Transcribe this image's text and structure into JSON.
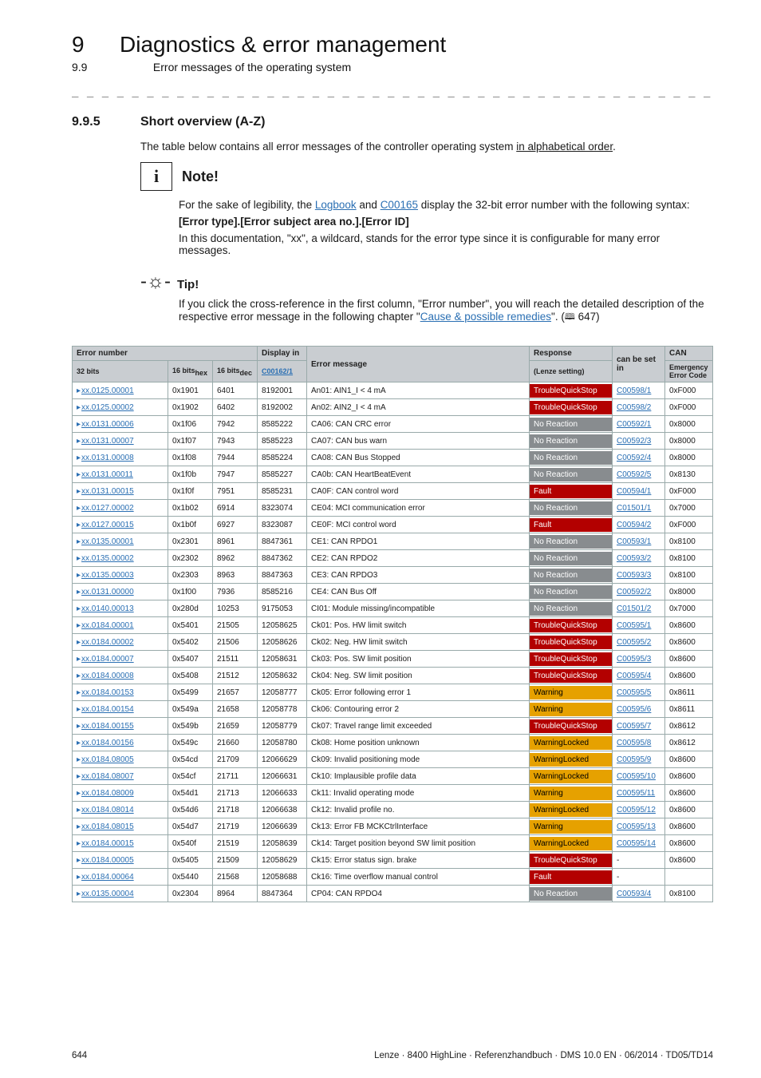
{
  "header": {
    "chapter_num": "9",
    "chapter_title": "Diagnostics & error management",
    "section_num": "9.9",
    "section_title": "Error messages of the operating system"
  },
  "sec": {
    "num": "9.9.5",
    "title": "Short overview (A-Z)"
  },
  "intro": {
    "pre": "The table below contains all error messages of the controller operating system ",
    "ul": "in alphabetical order",
    "post": "."
  },
  "note": {
    "title": "Note!",
    "p1a": "For the sake of legibility, the ",
    "link1": "Logbook",
    "p1b": " and ",
    "link2": "C00165",
    "p1c": " display the 32-bit error number with the following syntax:",
    "codeline": "[Error type].[Error subject area no.].[Error ID]",
    "p2": "In this documentation, \"xx\", a wildcard, stands for the error type since it is configurable for many error messages."
  },
  "tip": {
    "title": "Tip!",
    "p1": "If you click the cross-reference in the first column, \"Error number\", you will reach the detailed description of the respective error message in the following chapter \"",
    "link": "Cause & possible remedies",
    "p2": "\". ",
    "pageref": "647)"
  },
  "thead": {
    "c1a": "Error number",
    "c1b": "32 bits",
    "c2": "16 bits",
    "c2sub": "hex",
    "c3": "16 bits",
    "c3sub": "dec",
    "c4a": "Display in",
    "c4b": "C00162/1",
    "c5": "Error message",
    "c6a": "Response",
    "c6b": "(Lenze setting)",
    "c7": "can be set in",
    "c8a": "CAN",
    "c8b": "Emergency Error Code"
  },
  "rows": [
    {
      "en": "xx.0125.00001",
      "hex": "0x1901",
      "dec": "6401",
      "disp": "8192001",
      "msg": "An01: AIN1_I < 4 mA",
      "resp": "TroubleQuickStop",
      "set": "C00598/1",
      "can": "0xF000"
    },
    {
      "en": "xx.0125.00002",
      "hex": "0x1902",
      "dec": "6402",
      "disp": "8192002",
      "msg": "An02: AIN2_I < 4 mA",
      "resp": "TroubleQuickStop",
      "set": "C00598/2",
      "can": "0xF000"
    },
    {
      "en": "xx.0131.00006",
      "hex": "0x1f06",
      "dec": "7942",
      "disp": "8585222",
      "msg": "CA06: CAN CRC error",
      "resp": "No Reaction",
      "set": "C00592/1",
      "can": "0x8000"
    },
    {
      "en": "xx.0131.00007",
      "hex": "0x1f07",
      "dec": "7943",
      "disp": "8585223",
      "msg": "CA07: CAN bus warn",
      "resp": "No Reaction",
      "set": "C00592/3",
      "can": "0x8000"
    },
    {
      "en": "xx.0131.00008",
      "hex": "0x1f08",
      "dec": "7944",
      "disp": "8585224",
      "msg": "CA08: CAN Bus Stopped",
      "resp": "No Reaction",
      "set": "C00592/4",
      "can": "0x8000"
    },
    {
      "en": "xx.0131.00011",
      "hex": "0x1f0b",
      "dec": "7947",
      "disp": "8585227",
      "msg": "CA0b: CAN HeartBeatEvent",
      "resp": "No Reaction",
      "set": "C00592/5",
      "can": "0x8130"
    },
    {
      "en": "xx.0131.00015",
      "hex": "0x1f0f",
      "dec": "7951",
      "disp": "8585231",
      "msg": "CA0F: CAN control word",
      "resp": "Fault",
      "set": "C00594/1",
      "can": "0xF000"
    },
    {
      "en": "xx.0127.00002",
      "hex": "0x1b02",
      "dec": "6914",
      "disp": "8323074",
      "msg": "CE04: MCI communication error",
      "resp": "No Reaction",
      "set": "C01501/1",
      "can": "0x7000"
    },
    {
      "en": "xx.0127.00015",
      "hex": "0x1b0f",
      "dec": "6927",
      "disp": "8323087",
      "msg": "CE0F: MCI control word",
      "resp": "Fault",
      "set": "C00594/2",
      "can": "0xF000"
    },
    {
      "en": "xx.0135.00001",
      "hex": "0x2301",
      "dec": "8961",
      "disp": "8847361",
      "msg": "CE1: CAN RPDO1",
      "resp": "No Reaction",
      "set": "C00593/1",
      "can": "0x8100"
    },
    {
      "en": "xx.0135.00002",
      "hex": "0x2302",
      "dec": "8962",
      "disp": "8847362",
      "msg": "CE2: CAN RPDO2",
      "resp": "No Reaction",
      "set": "C00593/2",
      "can": "0x8100"
    },
    {
      "en": "xx.0135.00003",
      "hex": "0x2303",
      "dec": "8963",
      "disp": "8847363",
      "msg": "CE3: CAN RPDO3",
      "resp": "No Reaction",
      "set": "C00593/3",
      "can": "0x8100"
    },
    {
      "en": "xx.0131.00000",
      "hex": "0x1f00",
      "dec": "7936",
      "disp": "8585216",
      "msg": "CE4: CAN Bus Off",
      "resp": "No Reaction",
      "set": "C00592/2",
      "can": "0x8000"
    },
    {
      "en": "xx.0140.00013",
      "hex": "0x280d",
      "dec": "10253",
      "disp": "9175053",
      "msg": "CI01: Module missing/incompatible",
      "resp": "No Reaction",
      "set": "C01501/2",
      "can": "0x7000"
    },
    {
      "en": "xx.0184.00001",
      "hex": "0x5401",
      "dec": "21505",
      "disp": "12058625",
      "msg": "Ck01: Pos. HW limit switch",
      "resp": "TroubleQuickStop",
      "set": "C00595/1",
      "can": "0x8600"
    },
    {
      "en": "xx.0184.00002",
      "hex": "0x5402",
      "dec": "21506",
      "disp": "12058626",
      "msg": "Ck02: Neg. HW limit switch",
      "resp": "TroubleQuickStop",
      "set": "C00595/2",
      "can": "0x8600"
    },
    {
      "en": "xx.0184.00007",
      "hex": "0x5407",
      "dec": "21511",
      "disp": "12058631",
      "msg": "Ck03: Pos. SW limit position",
      "resp": "TroubleQuickStop",
      "set": "C00595/3",
      "can": "0x8600"
    },
    {
      "en": "xx.0184.00008",
      "hex": "0x5408",
      "dec": "21512",
      "disp": "12058632",
      "msg": "Ck04: Neg. SW limit position",
      "resp": "TroubleQuickStop",
      "set": "C00595/4",
      "can": "0x8600"
    },
    {
      "en": "xx.0184.00153",
      "hex": "0x5499",
      "dec": "21657",
      "disp": "12058777",
      "msg": "Ck05: Error following error 1",
      "resp": "Warning",
      "set": "C00595/5",
      "can": "0x8611"
    },
    {
      "en": "xx.0184.00154",
      "hex": "0x549a",
      "dec": "21658",
      "disp": "12058778",
      "msg": "Ck06: Contouring error 2",
      "resp": "Warning",
      "set": "C00595/6",
      "can": "0x8611"
    },
    {
      "en": "xx.0184.00155",
      "hex": "0x549b",
      "dec": "21659",
      "disp": "12058779",
      "msg": "Ck07: Travel range limit exceeded",
      "resp": "TroubleQuickStop",
      "set": "C00595/7",
      "can": "0x8612"
    },
    {
      "en": "xx.0184.00156",
      "hex": "0x549c",
      "dec": "21660",
      "disp": "12058780",
      "msg": "Ck08: Home position unknown",
      "resp": "WarningLocked",
      "set": "C00595/8",
      "can": "0x8612"
    },
    {
      "en": "xx.0184.08005",
      "hex": "0x54cd",
      "dec": "21709",
      "disp": "12066629",
      "msg": "Ck09: Invalid positioning mode",
      "resp": "WarningLocked",
      "set": "C00595/9",
      "can": "0x8600"
    },
    {
      "en": "xx.0184.08007",
      "hex": "0x54cf",
      "dec": "21711",
      "disp": "12066631",
      "msg": "Ck10: Implausible profile data",
      "resp": "WarningLocked",
      "set": "C00595/10",
      "can": "0x8600"
    },
    {
      "en": "xx.0184.08009",
      "hex": "0x54d1",
      "dec": "21713",
      "disp": "12066633",
      "msg": "Ck11: Invalid operating mode",
      "resp": "Warning",
      "set": "C00595/11",
      "can": "0x8600"
    },
    {
      "en": "xx.0184.08014",
      "hex": "0x54d6",
      "dec": "21718",
      "disp": "12066638",
      "msg": "Ck12: Invalid profile no.",
      "resp": "WarningLocked",
      "set": "C00595/12",
      "can": "0x8600"
    },
    {
      "en": "xx.0184.08015",
      "hex": "0x54d7",
      "dec": "21719",
      "disp": "12066639",
      "msg": "Ck13: Error FB MCKCtrlInterface",
      "resp": "Warning",
      "set": "C00595/13",
      "can": "0x8600"
    },
    {
      "en": "xx.0184.00015",
      "hex": "0x540f",
      "dec": "21519",
      "disp": "12058639",
      "msg": "Ck14: Target position beyond SW limit position",
      "resp": "WarningLocked",
      "set": "C00595/14",
      "can": "0x8600"
    },
    {
      "en": "xx.0184.00005",
      "hex": "0x5405",
      "dec": "21509",
      "disp": "12058629",
      "msg": "Ck15: Error status sign. brake",
      "resp": "TroubleQuickStop",
      "set": "-",
      "can": "0x8600"
    },
    {
      "en": "xx.0184.00064",
      "hex": "0x5440",
      "dec": "21568",
      "disp": "12058688",
      "msg": "Ck16: Time overflow manual control",
      "resp": "Fault",
      "set": "-",
      "can": ""
    },
    {
      "en": "xx.0135.00004",
      "hex": "0x2304",
      "dec": "8964",
      "disp": "8847364",
      "msg": "CP04: CAN RPDO4",
      "resp": "No Reaction",
      "set": "C00593/4",
      "can": "0x8100"
    }
  ],
  "footer": {
    "page": "644",
    "doc": "Lenze · 8400 HighLine · Referenzhandbuch · DMS 10.0 EN · 06/2014 · TD05/TD14"
  }
}
